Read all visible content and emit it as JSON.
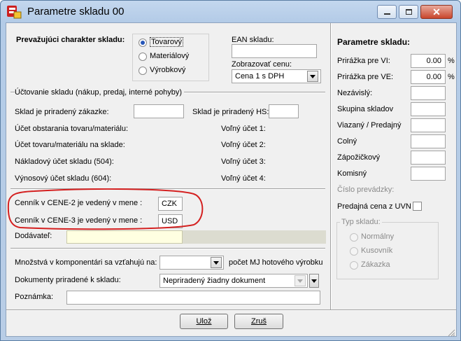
{
  "window": {
    "title": "Parametre skladu 00"
  },
  "left": {
    "character_label": "Prevažujúci charakter skladu:",
    "radios": [
      {
        "label": "Tovarový",
        "checked": true
      },
      {
        "label": "Materiálový",
        "checked": false
      },
      {
        "label": "Výrobkový",
        "checked": false
      }
    ],
    "ean_label": "EAN skladu:",
    "ean_value": "",
    "zobrazovat_label": "Zobrazovať cenu:",
    "zobrazovat_value": "Cena 1 s DPH",
    "uctovanie_header": "Účtovanie skladu (nákup, predaj, interné pohyby)",
    "sklad_zakazke_label": "Sklad je priradený zákazke:",
    "sklad_hs_label": "Sklad je priradený HS:",
    "ucet_obstarania": "Účet obstarania tovaru/materiálu:",
    "ucet_tovaru": "Účet tovaru/materiálu na sklade:",
    "nakladovy": "Nákladový účet skladu (504):",
    "vynosovy": "Výnosový účet skladu (604):",
    "volny1": "Voľný účet 1:",
    "volny2": "Voľný účet 2:",
    "volny3": "Voľný účet 3:",
    "volny4": "Voľný účet 4:",
    "cennik2_label": "Cenník v CENE-2 je vedený v mene :",
    "cennik2_value": "CZK",
    "cennik3_label": "Cenník v CENE-3 je vedený v mene :",
    "cennik3_value": "USD",
    "dodavatel_label": "Dodávateľ:",
    "mnozstva_label": "Množstvá v komponentári sa vzťahujú na:",
    "pocet_label": "počet MJ hotového výrobku",
    "dokumenty_label": "Dokumenty priradené k skladu:",
    "dokumenty_value": "Nepriradený žiadny dokument",
    "poznamka_label": "Poznámka:"
  },
  "right": {
    "header": "Parametre skladu:",
    "prirazka_vi_label": "Prirážka pre VI:",
    "prirazka_vi_value": "0.00",
    "prirazka_ve_label": "Prirážka pre VE:",
    "prirazka_ve_value": "0.00",
    "percent": "%",
    "nezavisly": "Nezávislý:",
    "skupina": "Skupina skladov",
    "viazany": "Viazaný / Predajný",
    "colny": "Colný",
    "zapozickovy": "Zápožičkový",
    "komisny": "Komisný",
    "cislo_prevadzky": "Číslo prevádzky:",
    "predajna_cena": "Predajná cena z UVN",
    "typ_skladu": "Typ skladu:",
    "typ_options": [
      "Normálny",
      "Kusovník",
      "Zákazka"
    ]
  },
  "buttons": {
    "save": "Ulož",
    "cancel": "Zruš"
  },
  "colors": {
    "highlight_circle": "#d42020",
    "dodavatel_bg": "#ffffe1",
    "accent_radio": "#2656b8"
  }
}
